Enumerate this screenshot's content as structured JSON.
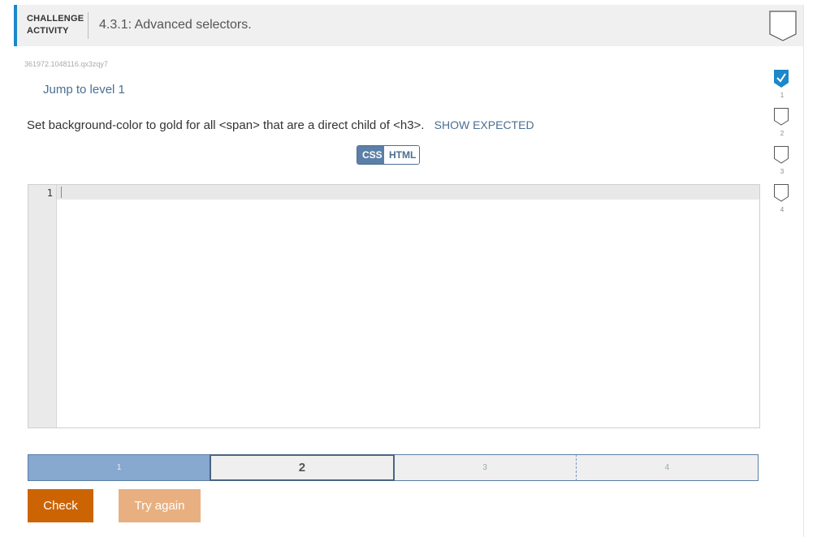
{
  "header": {
    "activity_type_line1": "CHALLENGE",
    "activity_type_line2": "ACTIVITY",
    "title": "4.3.1: Advanced selectors."
  },
  "activity_id": "361972.1048116.qx3zqy7",
  "jump_link": "Jump to level 1",
  "instruction": "Set background-color to gold for all <span> that are a direct child of <h3>.",
  "show_expected": "SHOW EXPECTED",
  "language_tabs": [
    {
      "label": "CSS",
      "active": true
    },
    {
      "label": "HTML",
      "active": false
    }
  ],
  "editor": {
    "line_numbers": [
      "1"
    ],
    "content": ""
  },
  "progress": {
    "segments": [
      {
        "label": "1",
        "state": "done"
      },
      {
        "label": "2",
        "state": "current"
      },
      {
        "label": "3",
        "state": "future"
      },
      {
        "label": "4",
        "state": "future"
      }
    ]
  },
  "buttons": {
    "check": "Check",
    "try_again": "Try again"
  },
  "levels": [
    {
      "number": "1",
      "completed": true
    },
    {
      "number": "2",
      "completed": false
    },
    {
      "number": "3",
      "completed": false
    },
    {
      "number": "4",
      "completed": false
    }
  ],
  "colors": {
    "accent_blue": "#1c87c9",
    "link_blue": "#4b6f94",
    "check_orange": "#cc6404",
    "try_again_orange": "#e8b080",
    "level_check_blue": "#1c87c9"
  }
}
